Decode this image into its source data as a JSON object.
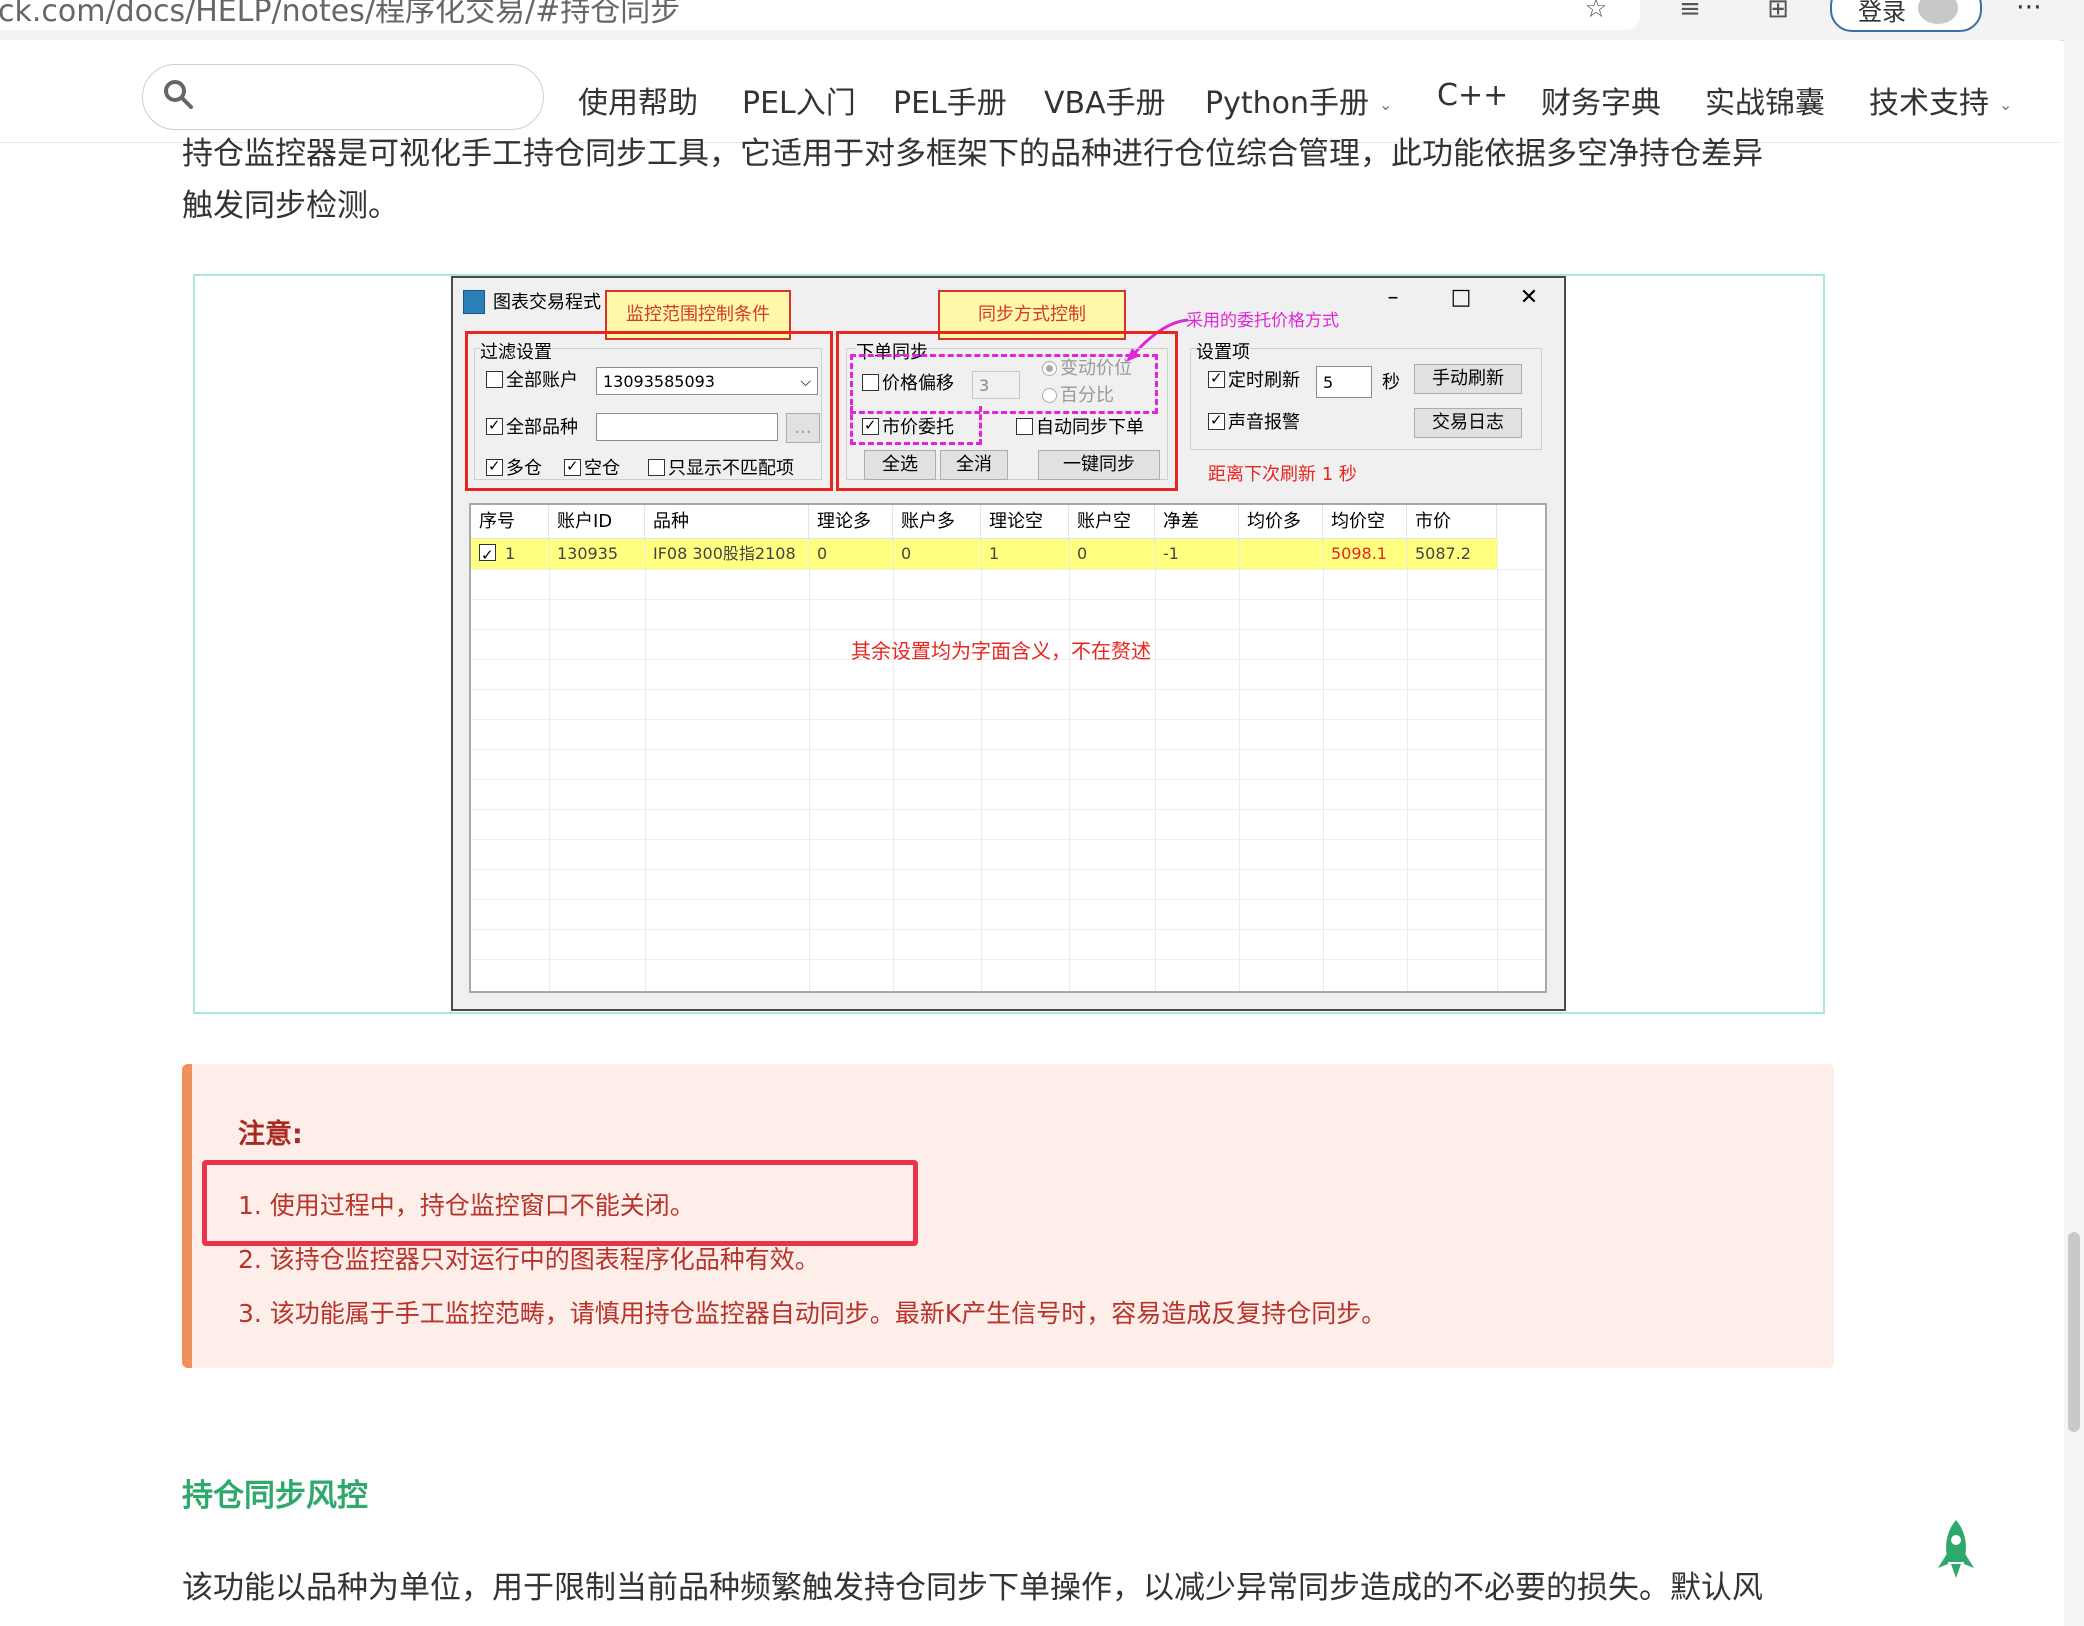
{
  "browser": {
    "address": "ck.com/docs/HELP/notes/程序化交易/#持仓同步",
    "login_label": "登录"
  },
  "nav": {
    "search_placeholder": "",
    "items": [
      "使用帮助",
      "PEL入门",
      "PEL手册",
      "VBA手册",
      "Python手册",
      "C++",
      "财务字典",
      "实战锦囊",
      "技术支持"
    ]
  },
  "article": {
    "intro_line1": "持仓监控器是可视化手工持仓同步工具，它适用于对多框架下的品种进行仓位综合管理，此功能依据多空净持仓差异",
    "intro_line2": "触发同步检测。",
    "section_heading": "持仓同步风控",
    "bottom_line": "该功能以品种为单位，用于限制当前品种频繁触发持仓同步下单操作，以减少异常同步造成的不必要的损失。默认风"
  },
  "window": {
    "title": "图表交易程式",
    "callout_filter": "监控范围控制条件",
    "callout_sync": "同步方式控制",
    "callout_price": "采用的委托价格方式",
    "filter_group": "过滤设置",
    "all_accounts": "全部账户",
    "account_value": "13093585093",
    "all_symbols": "全部品种",
    "browse": "...",
    "long": "多仓",
    "short": "空仓",
    "mismatch_only": "只显示不匹配项",
    "order_group": "下单同步",
    "price_offset": "价格偏移",
    "offset_value": "3",
    "radio_tick": "变动价位",
    "radio_percent": "百分比",
    "market_order": "市价委托",
    "auto_sync": "自动同步下单",
    "select_all": "全选",
    "deselect_all": "全消",
    "one_click_sync": "一键同步",
    "settings_group": "设置项",
    "timed_refresh": "定时刷新",
    "refresh_value": "5",
    "seconds": "秒",
    "manual_refresh": "手动刷新",
    "sound_alarm": "声音报警",
    "trade_log": "交易日志",
    "next_refresh": "距离下次刷新 1 秒",
    "grid_note": "其余设置均为字面含义，不在赘述",
    "columns": [
      "序号",
      "账户ID",
      "品种",
      "理论多",
      "账户多",
      "理论空",
      "账户空",
      "净差",
      "均价多",
      "均价空",
      "市价"
    ],
    "row": [
      "1",
      "130935",
      "IF08 300股指2108",
      "0",
      "0",
      "1",
      "0",
      "-1",
      "",
      "5098.1",
      "5087.2"
    ]
  },
  "note": {
    "title": "注意:",
    "items": [
      "1. 使用过程中，持仓监控窗口不能关闭。",
      "2. 该持仓监控器只对运行中的图表程序化品种有效。",
      "3. 该功能属于手工监控范畴，请慎用持仓监控器自动同步。最新K产生信号时，容易造成反复持仓同步。"
    ]
  },
  "colors": {
    "accent_green": "#2fa86b",
    "note_bg": "#fdeeea",
    "note_bar": "#f0905c",
    "alert_red": "#e8261e",
    "annot_magenta": "#e026d9"
  }
}
